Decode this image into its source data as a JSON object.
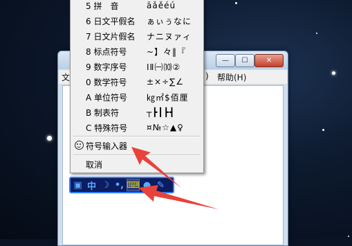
{
  "window": {
    "menu_help": "帮助(H)",
    "menu_partial_left": "文",
    "menu_partial_right": ")",
    "controls": {
      "minimize": "—",
      "maximize": "☐",
      "close": "✕"
    }
  },
  "context_menu": {
    "items": [
      {
        "label": "5 拼　音",
        "sample": "āǎěéú"
      },
      {
        "label": "6 日文平假名",
        "sample": "ぁぃぅなに"
      },
      {
        "label": "7 日文片假名",
        "sample": "ナニヌァィ"
      },
      {
        "label": "8 标点符号",
        "sample": "~】々‖『"
      },
      {
        "label": "9 数字序号",
        "sample": "ⅠⅡ㈠⑽②"
      },
      {
        "label": "0 数学符号",
        "sample": "±×÷∑∠"
      },
      {
        "label": "A 单位符号",
        "sample": "㎏㎡$佰厘"
      },
      {
        "label": "B 制表符",
        "sample": "┬┣┃┣┫"
      },
      {
        "label": "C 特殊符号",
        "sample": "¤№☆▲♀"
      }
    ],
    "symbol_input": "符号输入器",
    "cancel": "取消"
  },
  "ime_bar": {
    "buttons": [
      {
        "icon": "ime-logo-icon",
        "glyph": "▣"
      },
      {
        "icon": "chinese-mode-icon",
        "glyph": "中"
      },
      {
        "icon": "half-width-moon-icon",
        "glyph": "☽"
      },
      {
        "icon": "punctuation-icon",
        "glyph": "•,"
      },
      {
        "icon": "soft-keyboard-icon",
        "glyph": "⌨"
      },
      {
        "icon": "user-icon",
        "glyph": "●"
      },
      {
        "icon": "settings-wrench-icon",
        "glyph": "✎"
      }
    ]
  },
  "colors": {
    "arrow": "#e8423a",
    "ime_bar_bg": "#0c1c60",
    "ime_bar_border": "#2c80ff",
    "ime_active_glyph": "#d8d020"
  }
}
